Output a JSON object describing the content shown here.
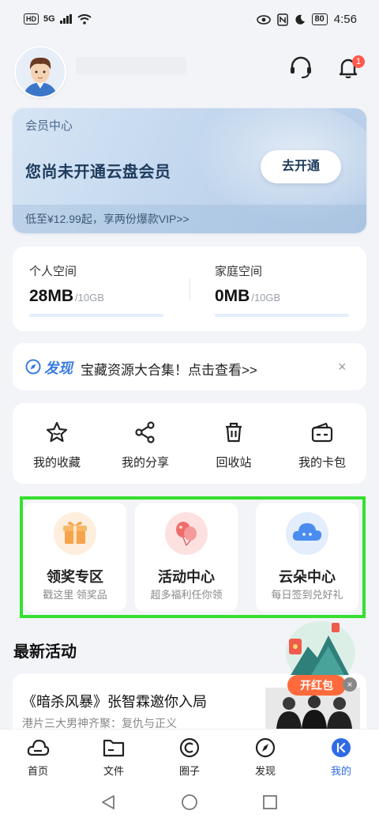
{
  "status_bar": {
    "hd": "HD",
    "network": "5G",
    "battery": "80",
    "time": "4:56"
  },
  "member": {
    "tag": "会员中心",
    "title": "您尚未开通云盘会员",
    "button": "去开通",
    "promo": "低至¥12.99起，享两份爆款VIP>>"
  },
  "notifications": {
    "badge": "1"
  },
  "storage": {
    "personal": {
      "label": "个人空间",
      "used": "28MB",
      "total": "/10GB",
      "fraction": 0.003
    },
    "family": {
      "label": "家庭空间",
      "used": "0MB",
      "total": "/10GB",
      "fraction": 0
    }
  },
  "discover": {
    "label": "发现",
    "text": "宝藏资源大合集！点击查看>>",
    "close": "×"
  },
  "tools": [
    {
      "label": "我的收藏",
      "icon": "star-icon"
    },
    {
      "label": "我的分享",
      "icon": "share-icon"
    },
    {
      "label": "回收站",
      "icon": "trash-icon"
    },
    {
      "label": "我的卡包",
      "icon": "card-wallet-icon"
    }
  ],
  "promos": [
    {
      "title": "领奖专区",
      "subtitle": "戳这里 领奖品",
      "icon": "gift-box-icon",
      "color": "#f7a34b"
    },
    {
      "title": "活动中心",
      "subtitle": "超多福利任你领",
      "icon": "balloon-icon",
      "color": "#ef6d6d"
    },
    {
      "title": "云朵中心",
      "subtitle": "每日签到兑好礼",
      "icon": "cloud-icon",
      "color": "#4b8cf0"
    }
  ],
  "latest": {
    "heading": "最新活动",
    "news_title": "《暗杀风暴》张智霖邀你入局",
    "news_sub": "港片三大男神齐聚：复仇与正义"
  },
  "red_packet": {
    "label": "开红包",
    "close": "×"
  },
  "tabbar": [
    {
      "label": "首页",
      "icon": "cloud-home-icon"
    },
    {
      "label": "文件",
      "icon": "folder-icon"
    },
    {
      "label": "圈子",
      "icon": "circle-icon"
    },
    {
      "label": "发现",
      "icon": "compass-icon"
    },
    {
      "label": "我的",
      "icon": "profile-icon",
      "active": true
    }
  ],
  "colors": {
    "accent": "#2f6ae6",
    "highlight": "#35e02e",
    "badge": "#ff5a4b",
    "red_packet": "#ff6a3c"
  }
}
